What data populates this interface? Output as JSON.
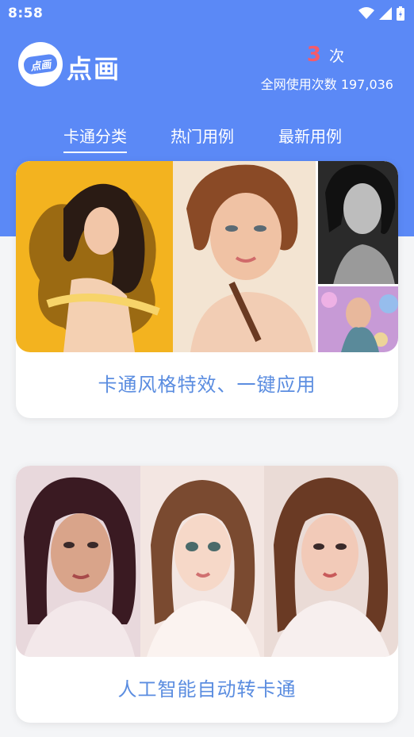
{
  "status_bar": {
    "time": "8:58"
  },
  "header": {
    "app_title": "点画",
    "logo_text": "点画",
    "count_value": "3",
    "count_unit": "次",
    "total_label": "全网使用次数 197,036"
  },
  "tabs": [
    {
      "label": "卡通分类",
      "active": true
    },
    {
      "label": "热门用例",
      "active": false
    },
    {
      "label": "最新用例",
      "active": false
    }
  ],
  "cards": [
    {
      "caption": "卡通风格特效、一键应用"
    },
    {
      "caption": "人工智能自动转卡通"
    }
  ],
  "colors": {
    "primary": "#5b89f6",
    "count_red": "#f45b6a",
    "caption_blue": "#5b8de0",
    "background": "#f4f5f7"
  }
}
